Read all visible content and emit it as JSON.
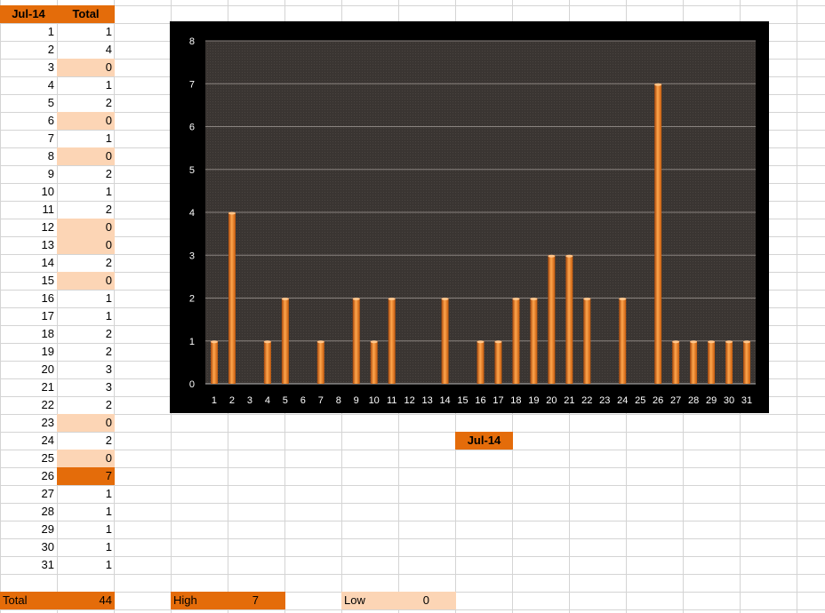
{
  "table": {
    "header_day": "Jul-14",
    "header_total": "Total",
    "rows": [
      {
        "day": "1",
        "total": "1"
      },
      {
        "day": "2",
        "total": "4"
      },
      {
        "day": "3",
        "total": "0"
      },
      {
        "day": "4",
        "total": "1"
      },
      {
        "day": "5",
        "total": "2"
      },
      {
        "day": "6",
        "total": "0"
      },
      {
        "day": "7",
        "total": "1"
      },
      {
        "day": "8",
        "total": "0"
      },
      {
        "day": "9",
        "total": "2"
      },
      {
        "day": "10",
        "total": "1"
      },
      {
        "day": "11",
        "total": "2"
      },
      {
        "day": "12",
        "total": "0"
      },
      {
        "day": "13",
        "total": "0"
      },
      {
        "day": "14",
        "total": "2"
      },
      {
        "day": "15",
        "total": "0"
      },
      {
        "day": "16",
        "total": "1"
      },
      {
        "day": "17",
        "total": "1"
      },
      {
        "day": "18",
        "total": "2"
      },
      {
        "day": "19",
        "total": "2"
      },
      {
        "day": "20",
        "total": "3"
      },
      {
        "day": "21",
        "total": "3"
      },
      {
        "day": "22",
        "total": "2"
      },
      {
        "day": "23",
        "total": "0"
      },
      {
        "day": "24",
        "total": "2"
      },
      {
        "day": "25",
        "total": "0"
      },
      {
        "day": "26",
        "total": "7"
      },
      {
        "day": "27",
        "total": "1"
      },
      {
        "day": "28",
        "total": "1"
      },
      {
        "day": "29",
        "total": "1"
      },
      {
        "day": "30",
        "total": "1"
      },
      {
        "day": "31",
        "total": "1"
      }
    ]
  },
  "summary": {
    "total_label": "Total",
    "total_value": "44",
    "high_label": "High",
    "high_value": "7",
    "low_label": "Low",
    "low_value": "0"
  },
  "month_label": "Jul-14",
  "colors": {
    "accent": "#E46C0A",
    "light": "#FCD5B5",
    "chart_bg": "#000000",
    "plot_bg": "#3A3532"
  },
  "chart_data": {
    "type": "bar",
    "categories": [
      "1",
      "2",
      "3",
      "4",
      "5",
      "6",
      "7",
      "8",
      "9",
      "10",
      "11",
      "12",
      "13",
      "14",
      "15",
      "16",
      "17",
      "18",
      "19",
      "20",
      "21",
      "22",
      "23",
      "24",
      "25",
      "26",
      "27",
      "28",
      "29",
      "30",
      "31"
    ],
    "values": [
      1,
      4,
      0,
      1,
      2,
      0,
      1,
      0,
      2,
      1,
      2,
      0,
      0,
      2,
      0,
      1,
      1,
      2,
      2,
      3,
      3,
      2,
      0,
      2,
      0,
      7,
      1,
      1,
      1,
      1,
      1
    ],
    "title": "",
    "xlabel": "",
    "ylabel": "",
    "ylim": [
      0,
      8
    ],
    "yticks": [
      "0",
      "1",
      "2",
      "3",
      "4",
      "5",
      "6",
      "7",
      "8"
    ],
    "grid": true,
    "legend": "none"
  }
}
